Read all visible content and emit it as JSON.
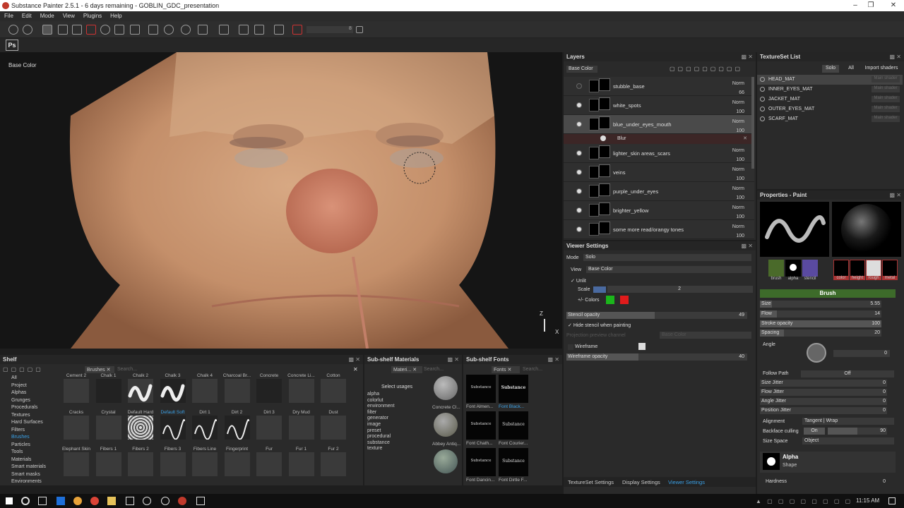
{
  "window": {
    "title": "Substance Painter 2.5.1 - 6 days remaining - GOBLIN_GDC_presentation"
  },
  "menu": [
    "File",
    "Edit",
    "Mode",
    "View",
    "Plugins",
    "Help"
  ],
  "toolbar": {
    "ps_label": "Ps",
    "value": "8"
  },
  "viewport": {
    "channel_label": "Base Color",
    "axis_z": "Z",
    "axis_x": "X"
  },
  "layers": {
    "title": "Layers",
    "channel": "Base Color",
    "rows": [
      {
        "name": "stubble_base",
        "blend": "Norm",
        "opacity": "66",
        "visible": false,
        "selected": false
      },
      {
        "name": "white_spots",
        "blend": "Norm",
        "opacity": "100",
        "visible": true,
        "selected": false
      },
      {
        "name": "blue_under_eyes_mouth",
        "blend": "Norm",
        "opacity": "100",
        "visible": true,
        "selected": true
      },
      {
        "name": "lighter_skin areas_scars",
        "blend": "Norm",
        "opacity": "100",
        "visible": true,
        "selected": false
      },
      {
        "name": "veins",
        "blend": "Norm",
        "opacity": "100",
        "visible": true,
        "selected": false
      },
      {
        "name": "purple_under_eyes",
        "blend": "Norm",
        "opacity": "100",
        "visible": true,
        "selected": false
      },
      {
        "name": "brighter_yellow",
        "blend": "Norm",
        "opacity": "100",
        "visible": true,
        "selected": false
      },
      {
        "name": "some more read/orangy tones",
        "blend": "Norm",
        "opacity": "100",
        "visible": true,
        "selected": false
      }
    ],
    "effect": {
      "name": "Blur"
    }
  },
  "textureset": {
    "title": "TextureSet List",
    "solo": "Solo",
    "all": "All",
    "import": "Import shaders",
    "main_shader": "Main shader",
    "items": [
      "HEAD_MAT",
      "INNER_EYES_MAT",
      "JACKET_MAT",
      "OUTER_EYES_MAT",
      "SCARF_MAT"
    ]
  },
  "properties": {
    "title": "Properties - Paint",
    "slots": [
      "brush",
      "alpha",
      "stencil"
    ],
    "materials": [
      "color",
      "height",
      "rough",
      "metal"
    ],
    "brush_header": "Brush",
    "size": {
      "label": "Size",
      "value": "5.55",
      "fraction": 0.1
    },
    "flow": {
      "label": "Flow",
      "value": "14",
      "fraction": 0.14
    },
    "stroke_opacity": {
      "label": "Stroke opacity",
      "value": "100",
      "fraction": 1.0
    },
    "spacing": {
      "label": "Spacing",
      "value": "20",
      "fraction": 0.2
    },
    "angle": {
      "label": "Angle",
      "value": "0"
    },
    "follow_path": {
      "label": "Follow Path",
      "value": "Off"
    },
    "size_jitter": {
      "label": "Size Jitter",
      "value": "0"
    },
    "flow_jitter": {
      "label": "Flow Jitter",
      "value": "0"
    },
    "angle_jitter": {
      "label": "Angle Jitter",
      "value": "0"
    },
    "position_jitter": {
      "label": "Position Jitter",
      "value": "0"
    },
    "alignment": {
      "label": "Alignment",
      "value": "Tangent | Wrap"
    },
    "backface": {
      "label": "Backface culling",
      "toggle": "On",
      "value": "90",
      "fraction": 0.5
    },
    "size_space": {
      "label": "Size Space",
      "value": "Object"
    },
    "alpha_title": "Alpha",
    "alpha_sub": "Shape",
    "hardness": {
      "label": "Hardness",
      "value": "0"
    }
  },
  "viewer": {
    "title": "Viewer Settings",
    "mode_label": "Mode",
    "mode": "Solo",
    "view_label": "View",
    "view": "Base Color",
    "unlit": "Unlit",
    "scale_label": "Scale",
    "scale": "2",
    "colors_label": "+/- Colors",
    "stencil_label": "Stencil opacity",
    "stencil": "49",
    "stencil_fraction": 0.49,
    "hide_stencil": "Hide stencil when painting",
    "proj_label": "Projection preview channel",
    "proj": "Base Color",
    "wireframe": "Wireframe",
    "wire_opacity_label": "Wireframe opacity",
    "wire_opacity": "40",
    "wire_fraction": 0.4,
    "tabs": [
      "TextureSet Settings",
      "Display Settings",
      "Viewer Settings"
    ]
  },
  "shelf": {
    "title": "Shelf",
    "tab": "Brushes",
    "search": "Search...",
    "categories": [
      "All",
      "Project",
      "Alphas",
      "Grunges",
      "Procedurals",
      "Textures",
      "Hard Surfaces",
      "Filters",
      "Brushes",
      "Particles",
      "Tools",
      "Materials",
      "Smart materials",
      "Smart masks",
      "Environments"
    ],
    "row1_labels": [
      "Cement 2",
      "Chalk 1",
      "Chalk 2",
      "Chalk 3",
      "Chalk 4",
      "Charcoal Br...",
      "Concrete",
      "Concrete Li...",
      "Cotton"
    ],
    "row2_labels": [
      "Cracks",
      "Crystal",
      "Default Hard",
      "Default Soft",
      "Dirt 1",
      "Dirt 2",
      "Dirt 3",
      "Dry Mud",
      "Dust"
    ],
    "row3_labels": [
      "Elephant Skin",
      "Fibers 1",
      "Fibers 2",
      "Fibers 3",
      "Fibers Line",
      "Fingerprint",
      "Fur",
      "Fur 1",
      "Fur 2"
    ]
  },
  "subshelf_mat": {
    "title": "Sub-shelf Materials",
    "tab": "Materi...",
    "search": "Search...",
    "usages": "Select usages",
    "list": [
      "alpha",
      "colorlut",
      "environment",
      "filter",
      "generator",
      "image",
      "preset",
      "procedural",
      "substance",
      "texture"
    ],
    "items": [
      "Concrete Cl...",
      "Abbey Antiq..."
    ]
  },
  "subshelf_fonts": {
    "title": "Sub-shelf Fonts",
    "tab": "Fonts",
    "search": "Search...",
    "items": [
      {
        "preview": "Substance",
        "label": "Font Almen..."
      },
      {
        "preview": "Substance",
        "label": "Font Black..."
      },
      {
        "preview": "Substance",
        "label": "Font Chath..."
      },
      {
        "preview": "Substance",
        "label": "Font Courier..."
      },
      {
        "preview": "Substance",
        "label": "Font Dancin..."
      },
      {
        "preview": "Substance",
        "label": "Font Dirtle F..."
      }
    ]
  },
  "taskbar": {
    "time": "11:15 AM"
  },
  "colors": {
    "accent": "#3aa0e6",
    "brush_header": "#3d6b2a",
    "selected": "#4a4a4a"
  }
}
